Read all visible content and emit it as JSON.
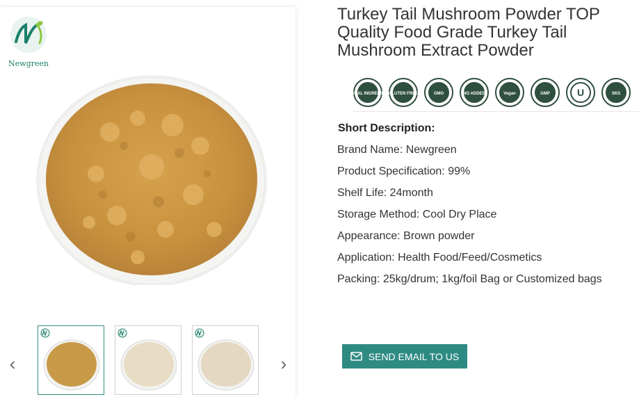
{
  "product": {
    "title": "Turkey Tail Mushroom Powder TOP Quality Food Grade Turkey Tail Mushroom Extract Powder",
    "short_description_label": "Short Description:",
    "specs": [
      "Brand Name: Newgreen",
      "Product Specification: 99%",
      "Shelf Life: 24month",
      "Storage Method: Cool Dry Place",
      "Appearance: Brown powder",
      "Application: Health Food/Feed/Cosmetics",
      "Packing: 25kg/drum; 1kg/foil Bag or Customized bags"
    ]
  },
  "gallery": {
    "brand_logo_text": "Newgreen",
    "prev_arrow": "‹",
    "next_arrow": "›",
    "thumbnails": [
      {
        "powder_color": "#c89a48",
        "active": true
      },
      {
        "powder_color": "#e8dcc4",
        "active": false
      },
      {
        "powder_color": "#e4d8c2",
        "active": false
      }
    ]
  },
  "certifications": [
    {
      "icon": "natural-ingredients-badge-icon",
      "text": "NATURAL INGREDIENTS"
    },
    {
      "icon": "gluten-free-badge-icon",
      "text": "GLUTEN FREE"
    },
    {
      "icon": "non-gmo-badge-icon",
      "text": "GMO"
    },
    {
      "icon": "no-preservatives-badge-icon",
      "text": "NO ADDED"
    },
    {
      "icon": "vegan-friendly-badge-icon",
      "text": "Vegan"
    },
    {
      "icon": "gmp-certified-badge-icon",
      "text": "GMP"
    },
    {
      "icon": "kosher-u-badge-icon",
      "text": "KOSHER"
    },
    {
      "icon": "kosher-sks-badge-icon",
      "text": "SKS"
    }
  ],
  "cta": {
    "send_email_label": "SEND EMAIL TO US"
  },
  "colors": {
    "brand_green": "#2e8b83",
    "badge_dark": "#2f4f3f"
  }
}
